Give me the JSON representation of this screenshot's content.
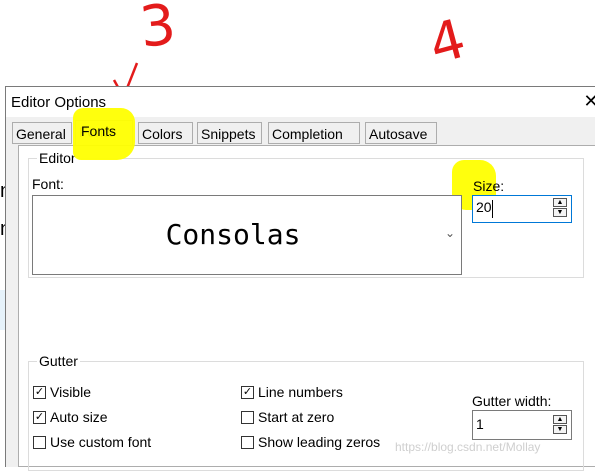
{
  "window": {
    "title": "Editor Options",
    "close_icon": "close-icon"
  },
  "tabs": [
    {
      "label": "General"
    },
    {
      "label": "Fonts",
      "active": true
    },
    {
      "label": "Colors"
    },
    {
      "label": "Snippets"
    },
    {
      "label": "Completion"
    },
    {
      "label": "Autosave"
    }
  ],
  "editor": {
    "group_label": "Editor",
    "font_label": "Font:",
    "font_value": "Consolas",
    "size_label": "Size:",
    "size_value": "20"
  },
  "gutter": {
    "group_label": "Gutter",
    "visible": {
      "label": "Visible",
      "checked": true
    },
    "auto_size": {
      "label": "Auto size",
      "checked": true
    },
    "custom_font": {
      "label": "Use custom font",
      "checked": false
    },
    "line_numbers": {
      "label": "Line numbers",
      "checked": true
    },
    "start_zero": {
      "label": "Start at zero",
      "checked": false
    },
    "leading_zeros": {
      "label": "Show leading zeros",
      "checked": false
    },
    "width_label": "Gutter width:",
    "width_value": "1"
  },
  "annotations": {
    "three": "3",
    "four": "4"
  },
  "watermark": "https://blog.csdn.net/Mollay",
  "colors": {
    "highlight": "#ffff00",
    "annotation": "#e31b1b",
    "focus": "#0078d7"
  }
}
